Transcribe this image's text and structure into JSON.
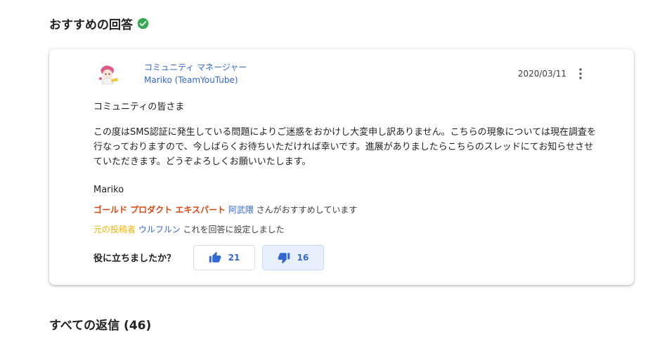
{
  "recommended_heading": "おすすめの回答",
  "answer": {
    "author_role": "コミュニティ マネージャー",
    "author_name": "Mariko (TeamYouTube)",
    "date": "2020/03/11",
    "greeting": "コミュニティの皆さま",
    "message": "この度はSMS認証に発生している問題によりご迷惑をおかけし大変申し訳ありません。こちらの現象については現在調査を行なっておりますので、今しばらくお待ちいただければ幸いです。進展がありましたらこちらのスレッドにてお知らせさせていただきます。どうぞよろしくお願いいたします。",
    "signature": "Mariko",
    "endorsement": {
      "badge": "ゴールド プロダクト エキスパート",
      "user": "阿武隈",
      "suffix": "さんがおすすめしています"
    },
    "accepted": {
      "badge": "元の投稿者",
      "user": "ウルフルン",
      "suffix": "これを回答に設定しました"
    },
    "helpful_label": "役に立ちましたか？",
    "upvotes": "21",
    "downvotes": "16"
  },
  "all_replies_heading": "すべての返信 (46)",
  "icons": {
    "check": "check-circle-icon",
    "more": "more-vert-icon",
    "thumbs_up": "thumbs-up-icon",
    "thumbs_down": "thumbs-down-icon",
    "avatar": "community-manager-avatar"
  },
  "colors": {
    "link": "#3367d6",
    "gold_expert": "#d9480f",
    "original_poster": "#f2b600",
    "check": "#34a853"
  }
}
